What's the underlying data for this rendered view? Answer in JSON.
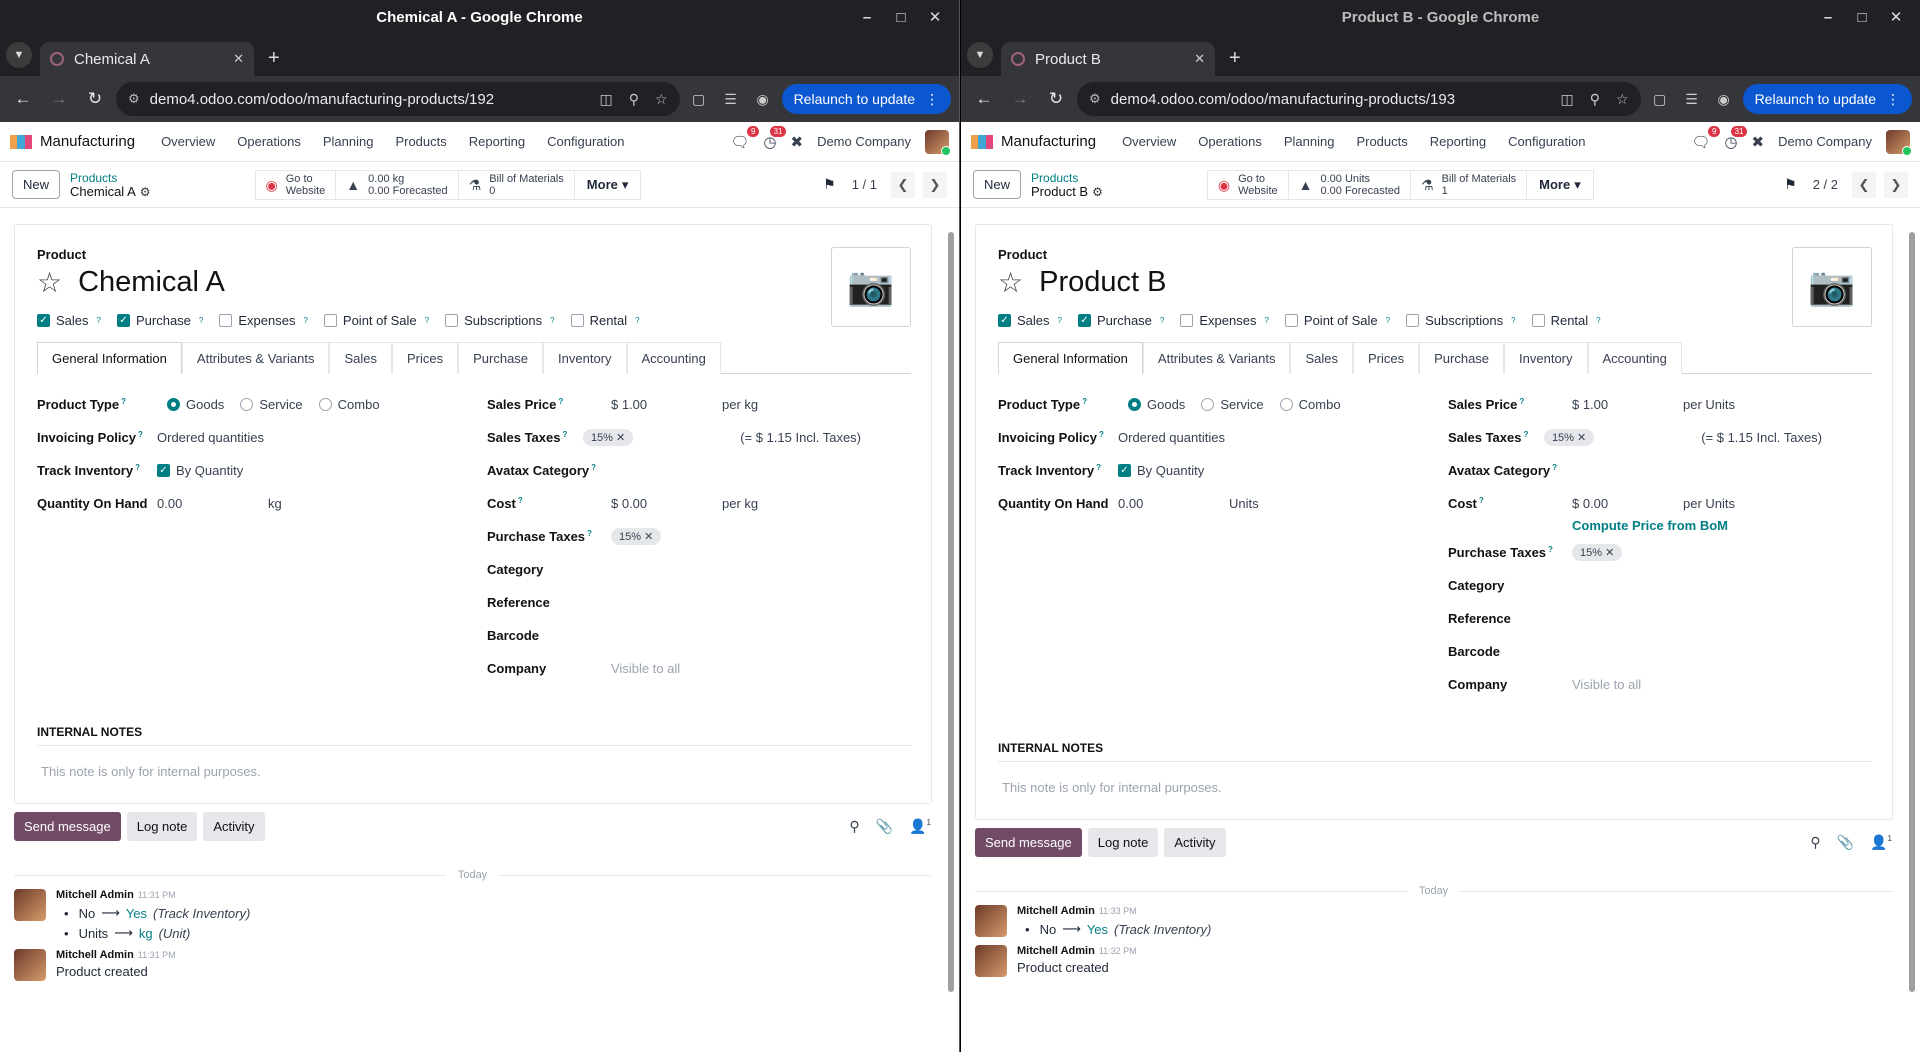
{
  "windows": [
    {
      "title": "Chemical A - Google Chrome",
      "tab": "Chemical A",
      "url": "demo4.odoo.com/odoo/manufacturing-products/192",
      "relaunch": "Relaunch to update",
      "app": "Manufacturing",
      "menu": [
        "Overview",
        "Operations",
        "Planning",
        "Products",
        "Reporting",
        "Configuration"
      ],
      "chat_badge": "9",
      "activity_badge": "31",
      "company": "Demo Company",
      "new_btn": "New",
      "breadcrumb_parent": "Products",
      "breadcrumb_current": "Chemical A",
      "smart": {
        "website_l1": "Go to",
        "website_l2": "Website",
        "forecast_l1": "0.00 kg",
        "forecast_l2": "0.00 Forecasted",
        "bom_l1": "Bill of Materials",
        "bom_l2": "0",
        "more": "More"
      },
      "pager": "1 / 1",
      "product_label": "Product",
      "product_name": "Chemical A",
      "checks": [
        {
          "label": "Sales",
          "checked": true
        },
        {
          "label": "Purchase",
          "checked": true
        },
        {
          "label": "Expenses",
          "checked": false
        },
        {
          "label": "Point of Sale",
          "checked": false
        },
        {
          "label": "Subscriptions",
          "checked": false
        },
        {
          "label": "Rental",
          "checked": false
        }
      ],
      "tabs": [
        "General Information",
        "Attributes & Variants",
        "Sales",
        "Prices",
        "Purchase",
        "Inventory",
        "Accounting"
      ],
      "left": {
        "product_type_label": "Product Type",
        "types": [
          "Goods",
          "Service",
          "Combo"
        ],
        "invoicing_label": "Invoicing Policy",
        "invoicing_value": "Ordered quantities",
        "track_label": "Track Inventory",
        "track_value": "By Quantity",
        "qoh_label": "Quantity On Hand",
        "qoh_value": "0.00",
        "qoh_unit": "kg"
      },
      "right": {
        "sales_price_label": "Sales Price",
        "sales_price": "$ 1.00",
        "sales_price_unit": "per kg",
        "sales_taxes_label": "Sales Taxes",
        "sales_tax_tag": "15%",
        "incl_taxes": "(= $ 1.15 Incl. Taxes)",
        "avatax_label": "Avatax Category",
        "cost_label": "Cost",
        "cost": "$ 0.00",
        "cost_unit": "per kg",
        "compute_link": "",
        "purchase_taxes_label": "Purchase Taxes",
        "purchase_tax_tag": "15%",
        "category_label": "Category",
        "reference_label": "Reference",
        "barcode_label": "Barcode",
        "company_label": "Company",
        "company_value": "Visible to all"
      },
      "notes_heading": "INTERNAL NOTES",
      "notes_placeholder": "This note is only for internal purposes.",
      "chatter": {
        "send": "Send message",
        "log": "Log note",
        "activity": "Activity",
        "followers": "1",
        "today": "Today",
        "messages": [
          {
            "author": "Mitchell Admin",
            "time": "11:31 PM",
            "changes": [
              {
                "old": "No",
                "new": "Yes",
                "field": "(Track Inventory)"
              },
              {
                "old": "Units",
                "new": "kg",
                "field": "(Unit)"
              }
            ]
          },
          {
            "author": "Mitchell Admin",
            "time": "11:31 PM",
            "text": "Product created"
          }
        ]
      }
    },
    {
      "title": "Product B - Google Chrome",
      "tab": "Product B",
      "url": "demo4.odoo.com/odoo/manufacturing-products/193",
      "relaunch": "Relaunch to update",
      "app": "Manufacturing",
      "menu": [
        "Overview",
        "Operations",
        "Planning",
        "Products",
        "Reporting",
        "Configuration"
      ],
      "chat_badge": "9",
      "activity_badge": "31",
      "company": "Demo Company",
      "new_btn": "New",
      "breadcrumb_parent": "Products",
      "breadcrumb_current": "Product B",
      "smart": {
        "website_l1": "Go to",
        "website_l2": "Website",
        "forecast_l1": "0.00 Units",
        "forecast_l2": "0.00 Forecasted",
        "bom_l1": "Bill of Materials",
        "bom_l2": "1",
        "more": "More"
      },
      "pager": "2 / 2",
      "product_label": "Product",
      "product_name": "Product B",
      "checks": [
        {
          "label": "Sales",
          "checked": true
        },
        {
          "label": "Purchase",
          "checked": true
        },
        {
          "label": "Expenses",
          "checked": false
        },
        {
          "label": "Point of Sale",
          "checked": false
        },
        {
          "label": "Subscriptions",
          "checked": false
        },
        {
          "label": "Rental",
          "checked": false
        }
      ],
      "tabs": [
        "General Information",
        "Attributes & Variants",
        "Sales",
        "Prices",
        "Purchase",
        "Inventory",
        "Accounting"
      ],
      "left": {
        "product_type_label": "Product Type",
        "types": [
          "Goods",
          "Service",
          "Combo"
        ],
        "invoicing_label": "Invoicing Policy",
        "invoicing_value": "Ordered quantities",
        "track_label": "Track Inventory",
        "track_value": "By Quantity",
        "qoh_label": "Quantity On Hand",
        "qoh_value": "0.00",
        "qoh_unit": "Units"
      },
      "right": {
        "sales_price_label": "Sales Price",
        "sales_price": "$ 1.00",
        "sales_price_unit": "per Units",
        "sales_taxes_label": "Sales Taxes",
        "sales_tax_tag": "15%",
        "incl_taxes": "(= $ 1.15 Incl. Taxes)",
        "avatax_label": "Avatax Category",
        "cost_label": "Cost",
        "cost": "$ 0.00",
        "cost_unit": "per Units",
        "compute_link": "Compute Price from BoM",
        "purchase_taxes_label": "Purchase Taxes",
        "purchase_tax_tag": "15%",
        "category_label": "Category",
        "reference_label": "Reference",
        "barcode_label": "Barcode",
        "company_label": "Company",
        "company_value": "Visible to all"
      },
      "notes_heading": "INTERNAL NOTES",
      "notes_placeholder": "This note is only for internal purposes.",
      "chatter": {
        "send": "Send message",
        "log": "Log note",
        "activity": "Activity",
        "followers": "1",
        "today": "Today",
        "messages": [
          {
            "author": "Mitchell Admin",
            "time": "11:33 PM",
            "changes": [
              {
                "old": "No",
                "new": "Yes",
                "field": "(Track Inventory)"
              }
            ]
          },
          {
            "author": "Mitchell Admin",
            "time": "11:32 PM",
            "text": "Product created"
          }
        ]
      }
    }
  ]
}
